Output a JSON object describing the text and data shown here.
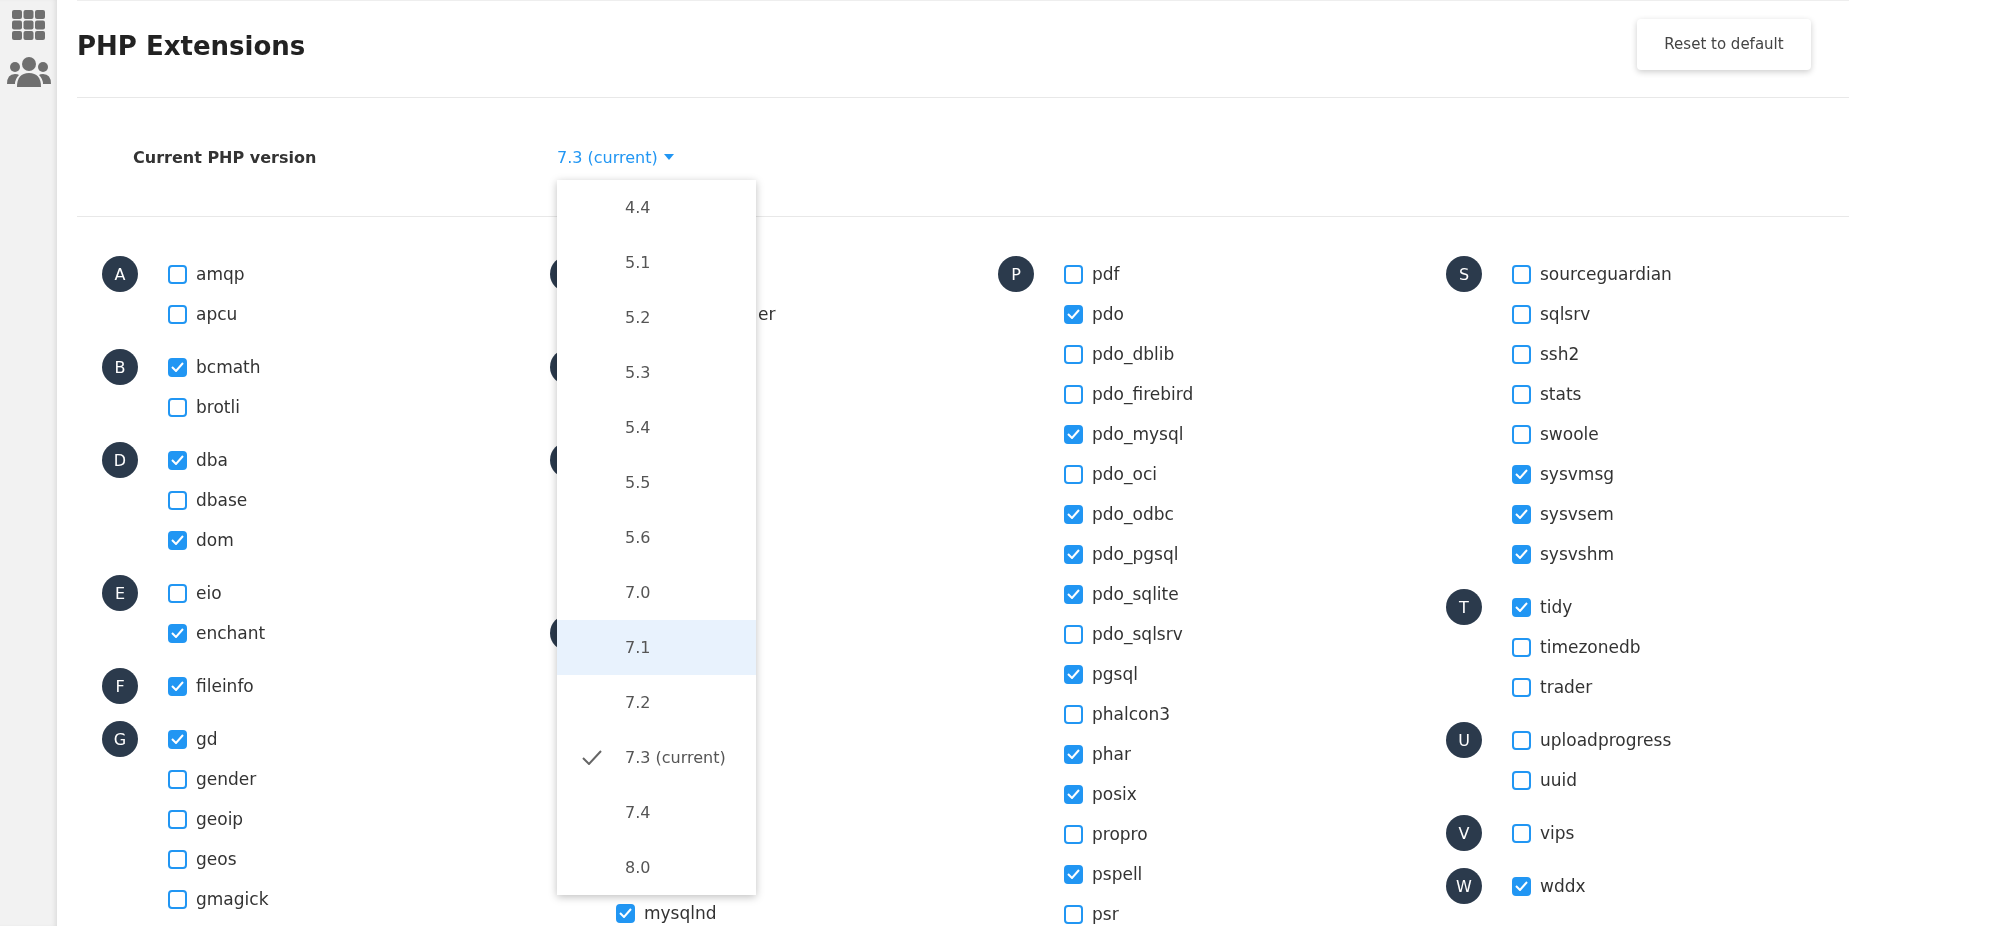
{
  "page": {
    "title": "PHP Extensions",
    "reset_button": "Reset to default"
  },
  "version": {
    "label": "Current PHP version",
    "value": "7.3 (current)",
    "menu_open": true,
    "options": [
      {
        "label": "4.4",
        "selected": false,
        "highlighted": false
      },
      {
        "label": "5.1",
        "selected": false,
        "highlighted": false
      },
      {
        "label": "5.2",
        "selected": false,
        "highlighted": false
      },
      {
        "label": "5.3",
        "selected": false,
        "highlighted": false
      },
      {
        "label": "5.4",
        "selected": false,
        "highlighted": false
      },
      {
        "label": "5.5",
        "selected": false,
        "highlighted": false
      },
      {
        "label": "5.6",
        "selected": false,
        "highlighted": false
      },
      {
        "label": "7.0",
        "selected": false,
        "highlighted": false
      },
      {
        "label": "7.1",
        "selected": false,
        "highlighted": true
      },
      {
        "label": "7.2",
        "selected": false,
        "highlighted": false
      },
      {
        "label": "7.3 (current)",
        "selected": true,
        "highlighted": false
      },
      {
        "label": "7.4",
        "selected": false,
        "highlighted": false
      },
      {
        "label": "8.0",
        "selected": false,
        "highlighted": false
      }
    ]
  },
  "columns": [
    [
      {
        "letter": "A",
        "items": [
          {
            "kind": "checkbox",
            "label": "amqp",
            "checked": false
          },
          {
            "kind": "checkbox",
            "label": "apcu",
            "checked": false
          }
        ]
      },
      {
        "letter": "B",
        "items": [
          {
            "kind": "checkbox",
            "label": "bcmath",
            "checked": true
          },
          {
            "kind": "checkbox",
            "label": "brotli",
            "checked": false
          }
        ]
      },
      {
        "letter": "D",
        "items": [
          {
            "kind": "checkbox",
            "label": "dba",
            "checked": true
          },
          {
            "kind": "checkbox",
            "label": "dbase",
            "checked": false
          },
          {
            "kind": "checkbox",
            "label": "dom",
            "checked": true
          }
        ]
      },
      {
        "letter": "E",
        "items": [
          {
            "kind": "checkbox",
            "label": "eio",
            "checked": false
          },
          {
            "kind": "checkbox",
            "label": "enchant",
            "checked": true
          }
        ]
      },
      {
        "letter": "F",
        "items": [
          {
            "kind": "checkbox",
            "label": "fileinfo",
            "checked": true
          }
        ]
      },
      {
        "letter": "G",
        "items": [
          {
            "kind": "checkbox",
            "label": "gd",
            "checked": true
          },
          {
            "kind": "checkbox",
            "label": "gender",
            "checked": false
          },
          {
            "kind": "checkbox",
            "label": "geoip",
            "checked": false
          },
          {
            "kind": "checkbox",
            "label": "geos",
            "checked": false
          },
          {
            "kind": "checkbox",
            "label": "gmagick",
            "checked": false
          }
        ]
      }
    ],
    [
      {
        "items": [
          {
            "kind": "covered"
          },
          {
            "kind": "fragment",
            "label": "er"
          }
        ]
      },
      {
        "items": [
          {
            "kind": "covered"
          },
          {
            "kind": "covered"
          }
        ]
      },
      {
        "items": [
          {
            "kind": "covered"
          },
          {
            "kind": "covered"
          },
          {
            "kind": "covered"
          },
          {
            "kind": "covered"
          }
        ]
      },
      {
        "items": [
          {
            "kind": "covered"
          },
          {
            "kind": "covered"
          },
          {
            "kind": "covered"
          },
          {
            "kind": "covered"
          },
          {
            "kind": "covered"
          },
          {
            "kind": "covered"
          },
          {
            "kind": "covered"
          },
          {
            "kind": "checkbox",
            "label": "mysqlnd",
            "checked": true
          }
        ]
      }
    ],
    [
      {
        "letter": "P",
        "items": [
          {
            "kind": "checkbox",
            "label": "pdf",
            "checked": false
          },
          {
            "kind": "checkbox",
            "label": "pdo",
            "checked": true
          },
          {
            "kind": "checkbox",
            "label": "pdo_dblib",
            "checked": false
          },
          {
            "kind": "checkbox",
            "label": "pdo_firebird",
            "checked": false
          },
          {
            "kind": "checkbox",
            "label": "pdo_mysql",
            "checked": true
          },
          {
            "kind": "checkbox",
            "label": "pdo_oci",
            "checked": false
          },
          {
            "kind": "checkbox",
            "label": "pdo_odbc",
            "checked": true
          },
          {
            "kind": "checkbox",
            "label": "pdo_pgsql",
            "checked": true
          },
          {
            "kind": "checkbox",
            "label": "pdo_sqlite",
            "checked": true
          },
          {
            "kind": "checkbox",
            "label": "pdo_sqlsrv",
            "checked": false
          },
          {
            "kind": "checkbox",
            "label": "pgsql",
            "checked": true
          },
          {
            "kind": "checkbox",
            "label": "phalcon3",
            "checked": false
          },
          {
            "kind": "checkbox",
            "label": "phar",
            "checked": true
          },
          {
            "kind": "checkbox",
            "label": "posix",
            "checked": true
          },
          {
            "kind": "checkbox",
            "label": "propro",
            "checked": false
          },
          {
            "kind": "checkbox",
            "label": "pspell",
            "checked": true
          },
          {
            "kind": "checkbox",
            "label": "psr",
            "checked": false
          }
        ]
      }
    ],
    [
      {
        "letter": "S",
        "items": [
          {
            "kind": "checkbox",
            "label": "sourceguardian",
            "checked": false
          },
          {
            "kind": "checkbox",
            "label": "sqlsrv",
            "checked": false
          },
          {
            "kind": "checkbox",
            "label": "ssh2",
            "checked": false
          },
          {
            "kind": "checkbox",
            "label": "stats",
            "checked": false
          },
          {
            "kind": "checkbox",
            "label": "swoole",
            "checked": false
          },
          {
            "kind": "checkbox",
            "label": "sysvmsg",
            "checked": true
          },
          {
            "kind": "checkbox",
            "label": "sysvsem",
            "checked": true
          },
          {
            "kind": "checkbox",
            "label": "sysvshm",
            "checked": true
          }
        ]
      },
      {
        "letter": "T",
        "items": [
          {
            "kind": "checkbox",
            "label": "tidy",
            "checked": true
          },
          {
            "kind": "checkbox",
            "label": "timezonedb",
            "checked": false
          },
          {
            "kind": "checkbox",
            "label": "trader",
            "checked": false
          }
        ]
      },
      {
        "letter": "U",
        "items": [
          {
            "kind": "checkbox",
            "label": "uploadprogress",
            "checked": false
          },
          {
            "kind": "checkbox",
            "label": "uuid",
            "checked": false
          }
        ]
      },
      {
        "letter": "V",
        "items": [
          {
            "kind": "checkbox",
            "label": "vips",
            "checked": false
          }
        ]
      },
      {
        "letter": "W",
        "items": [
          {
            "kind": "checkbox",
            "label": "wddx",
            "checked": true
          }
        ]
      }
    ]
  ]
}
